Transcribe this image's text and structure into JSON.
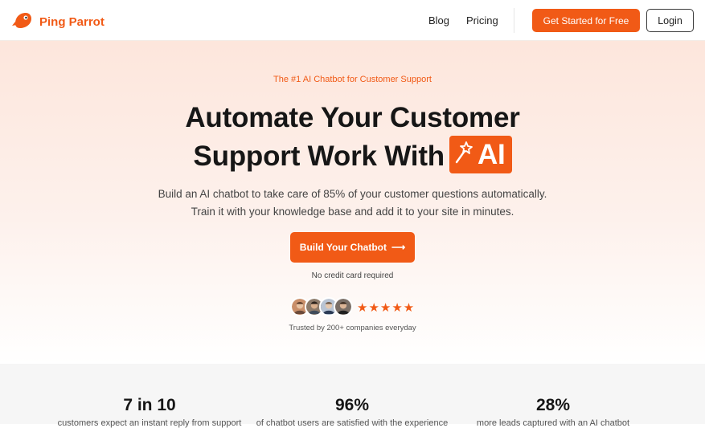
{
  "brand": {
    "name": "Ping Parrot",
    "accent": "#f15a16"
  },
  "nav": {
    "links": [
      "Blog",
      "Pricing"
    ],
    "cta_label": "Get Started for Free",
    "login_label": "Login"
  },
  "hero": {
    "tagline": "The #1 AI Chatbot for Customer Support",
    "title_line1": "Automate Your Customer",
    "title_line2": "Support Work With",
    "ai_badge": "AI",
    "subtitle_line1": "Build an AI chatbot to take care of 85% of your customer questions automatically.",
    "subtitle_line2": "Train it with your knowledge base and add it to your site in minutes.",
    "cta_label": "Build Your Chatbot",
    "cta_arrow": "⟶",
    "note": "No credit card required",
    "stars": "★★★★★",
    "trusted": "Trusted by 200+ companies everyday"
  },
  "stats": [
    {
      "value": "7 in 10",
      "desc": "customers expect an instant reply from support"
    },
    {
      "value": "96%",
      "desc": "of chatbot users are satisfied with the experience"
    },
    {
      "value": "28%",
      "desc": "more leads captured with an AI chatbot"
    }
  ]
}
